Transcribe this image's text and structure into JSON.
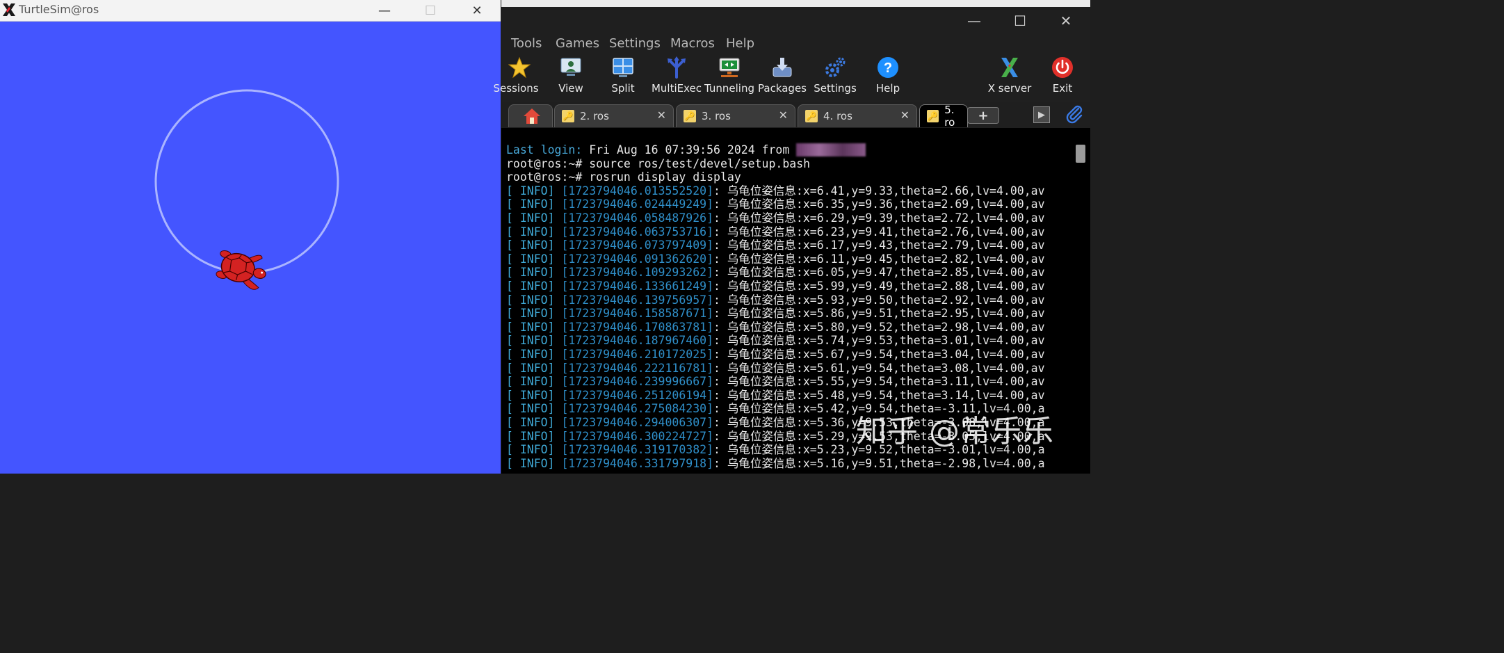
{
  "turtle_window": {
    "title": "TurtleSim@ros",
    "background": "#4455ff",
    "trail_color": "#b0b8ff",
    "turtle_color": "#d42222",
    "controls": {
      "minimize": "—",
      "maximize": "☐",
      "close": "✕"
    }
  },
  "moba_window": {
    "controls": {
      "minimize": "—",
      "maximize": "☐",
      "close": "✕"
    },
    "menu": [
      "Tools",
      "Games",
      "Settings",
      "Macros",
      "Help"
    ],
    "toolbar": [
      {
        "label": "Sessions",
        "icon": "star-icon"
      },
      {
        "label": "View",
        "icon": "view-icon"
      },
      {
        "label": "Split",
        "icon": "split-icon"
      },
      {
        "label": "MultiExec",
        "icon": "multiexec-icon"
      },
      {
        "label": "Tunneling",
        "icon": "tunneling-icon"
      },
      {
        "label": "Packages",
        "icon": "packages-icon"
      },
      {
        "label": "Settings",
        "icon": "settings-icon"
      },
      {
        "label": "Help",
        "icon": "help-icon"
      },
      {
        "label": "X server",
        "icon": "xserver-icon"
      },
      {
        "label": "Exit",
        "icon": "exit-icon"
      }
    ],
    "tabs": [
      {
        "label": "2. ros"
      },
      {
        "label": "3. ros"
      },
      {
        "label": "4. ros"
      },
      {
        "label": "5. ro"
      }
    ],
    "new_tab_symbol": "+",
    "play_symbol": "▶"
  },
  "terminal": {
    "last_login_prefix": "Last login:",
    "last_login_value": " Fri Aug 16 07:39:56 2024 from ",
    "commands": [
      "root@ros:~# source ros/test/devel/setup.bash",
      "root@ros:~# rosrun display display"
    ],
    "log_level": "[ INFO]",
    "log_lines": [
      {
        "ts": "[1723794046.013552520]",
        "msg": ": 乌龟位姿信息:x=6.41,y=9.33,theta=2.66,lv=4.00,av"
      },
      {
        "ts": "[1723794046.024449249]",
        "msg": ": 乌龟位姿信息:x=6.35,y=9.36,theta=2.69,lv=4.00,av"
      },
      {
        "ts": "[1723794046.058487926]",
        "msg": ": 乌龟位姿信息:x=6.29,y=9.39,theta=2.72,lv=4.00,av"
      },
      {
        "ts": "[1723794046.063753716]",
        "msg": ": 乌龟位姿信息:x=6.23,y=9.41,theta=2.76,lv=4.00,av"
      },
      {
        "ts": "[1723794046.073797409]",
        "msg": ": 乌龟位姿信息:x=6.17,y=9.43,theta=2.79,lv=4.00,av"
      },
      {
        "ts": "[1723794046.091362620]",
        "msg": ": 乌龟位姿信息:x=6.11,y=9.45,theta=2.82,lv=4.00,av"
      },
      {
        "ts": "[1723794046.109293262]",
        "msg": ": 乌龟位姿信息:x=6.05,y=9.47,theta=2.85,lv=4.00,av"
      },
      {
        "ts": "[1723794046.133661249]",
        "msg": ": 乌龟位姿信息:x=5.99,y=9.49,theta=2.88,lv=4.00,av"
      },
      {
        "ts": "[1723794046.139756957]",
        "msg": ": 乌龟位姿信息:x=5.93,y=9.50,theta=2.92,lv=4.00,av"
      },
      {
        "ts": "[1723794046.158587671]",
        "msg": ": 乌龟位姿信息:x=5.86,y=9.51,theta=2.95,lv=4.00,av"
      },
      {
        "ts": "[1723794046.170863781]",
        "msg": ": 乌龟位姿信息:x=5.80,y=9.52,theta=2.98,lv=4.00,av"
      },
      {
        "ts": "[1723794046.187967460]",
        "msg": ": 乌龟位姿信息:x=5.74,y=9.53,theta=3.01,lv=4.00,av"
      },
      {
        "ts": "[1723794046.210172025]",
        "msg": ": 乌龟位姿信息:x=5.67,y=9.54,theta=3.04,lv=4.00,av"
      },
      {
        "ts": "[1723794046.222116781]",
        "msg": ": 乌龟位姿信息:x=5.61,y=9.54,theta=3.08,lv=4.00,av"
      },
      {
        "ts": "[1723794046.239996667]",
        "msg": ": 乌龟位姿信息:x=5.55,y=9.54,theta=3.11,lv=4.00,av"
      },
      {
        "ts": "[1723794046.251206194]",
        "msg": ": 乌龟位姿信息:x=5.48,y=9.54,theta=3.14,lv=4.00,av"
      },
      {
        "ts": "[1723794046.275084230]",
        "msg": ": 乌龟位姿信息:x=5.42,y=9.54,theta=-3.11,lv=4.00,a"
      },
      {
        "ts": "[1723794046.294006307]",
        "msg": ": 乌龟位姿信息:x=5.36,y=9.53,theta=-3.08,lv=4.00,a"
      },
      {
        "ts": "[1723794046.300224727]",
        "msg": ": 乌龟位姿信息:x=5.29,y=9.53,theta=-3.05,lv=4.00,a"
      },
      {
        "ts": "[1723794046.319170382]",
        "msg": ": 乌龟位姿信息:x=5.23,y=9.52,theta=-3.01,lv=4.00,a"
      },
      {
        "ts": "[1723794046.331797918]",
        "msg": ": 乌龟位姿信息:x=5.16,y=9.51,theta=-2.98,lv=4.00,a"
      }
    ]
  },
  "watermark": "知乎 @常乐乐"
}
